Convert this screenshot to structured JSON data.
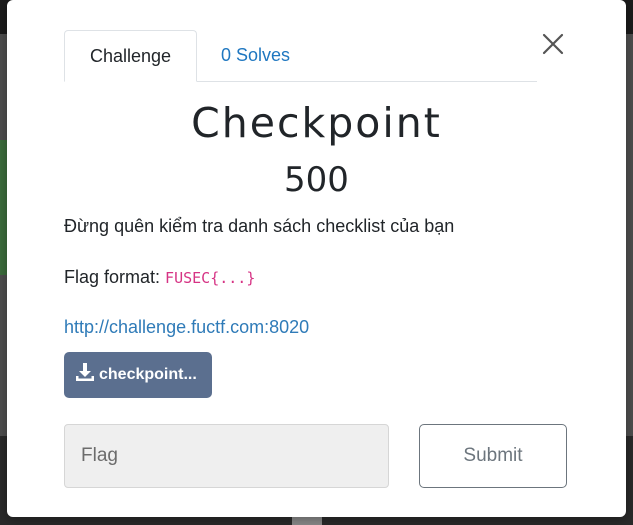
{
  "modal": {
    "tabs": [
      {
        "label": "Challenge"
      },
      {
        "label": "0 Solves"
      }
    ],
    "title": "Checkpoint",
    "value": "500",
    "description": "Đừng quên kiểm tra danh sách checklist của bạn",
    "flag_format_label": "Flag format:",
    "flag_format_code": "FUSEC{...}",
    "url": "http://challenge.fuctf.com:8020",
    "file_button_label": "checkpoint...",
    "flag_input_placeholder": "Flag",
    "submit_label": "Submit",
    "close_icon": "close-icon",
    "download_icon": "download-icon"
  },
  "colors": {
    "link": "#2f7bb8",
    "code": "#d63384",
    "file_button": "#5b6f8f",
    "submit_border": "#6c757d"
  }
}
